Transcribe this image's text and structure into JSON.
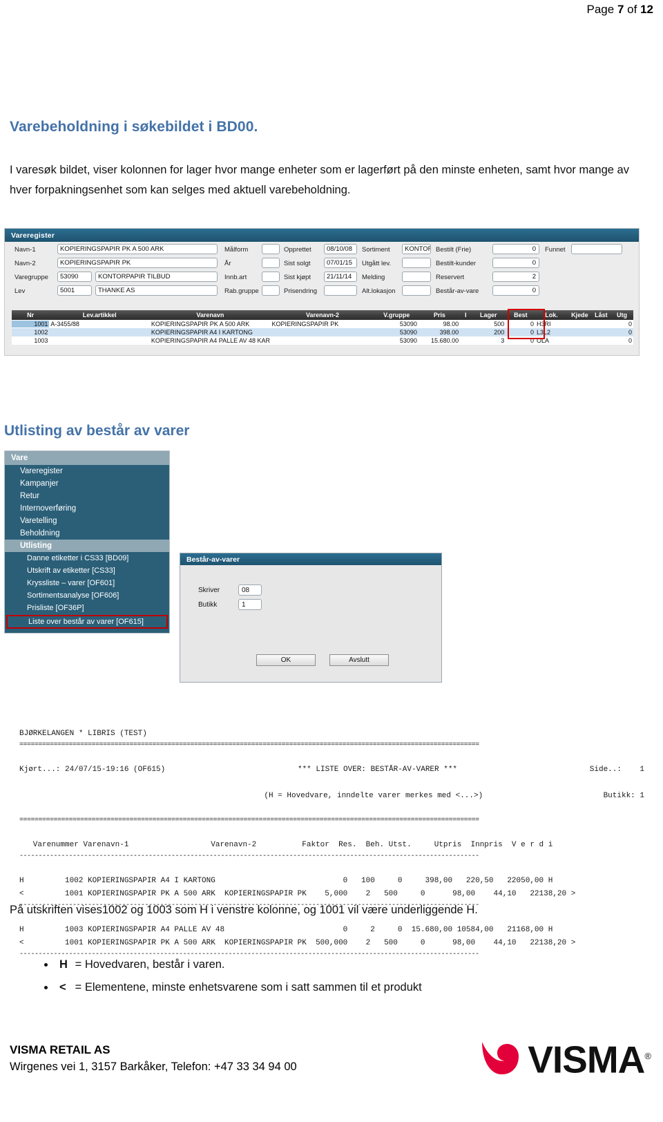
{
  "page_header": {
    "prefix": "Page",
    "current": "7",
    "middle": "of",
    "total": "12"
  },
  "section1": {
    "title": "Varebeholdning i søkebildet i BD00.",
    "intro": "I varesøk bildet, viser kolonnen for lager hvor mange enheter som er lagerført på den minste enheten, samt hvor mange av hver forpakningsenhet som kan selges med aktuell varebeholdning."
  },
  "vareregister": {
    "window_title": "Vareregister",
    "fields": {
      "navn1_label": "Navn-1",
      "navn1_value": "KOPIERINGSPAPIR PK A 500 ARK",
      "navn2_label": "Navn-2",
      "navn2_value": "KOPIERINGSPAPIR PK",
      "varegruppe_label": "Varegruppe",
      "varegruppe_code": "53090",
      "varegruppe_text": "KONTORPAPIR TILBUD",
      "lev_label": "Lev",
      "lev_code": "5001",
      "lev_text": "THANKE AS",
      "malform_label": "Målform",
      "malform_value": "",
      "ar_label": "År",
      "ar_value": "",
      "innbart_label": "Innb.art",
      "innbart_value": "",
      "rabgruppe_label": "Rab.gruppe",
      "rabgruppe_value": "",
      "opprettet_label": "Opprettet",
      "opprettet_value": "08/10/08",
      "sistsolgt_label": "Sist solgt",
      "sistsolgt_value": "07/01/15",
      "sistkjopt_label": "Sist kjøpt",
      "sistkjopt_value": "21/11/14",
      "prisendring_label": "Prisendring",
      "prisendring_value": "",
      "sortiment_label": "Sortiment",
      "sortiment_value": "KONTOR",
      "utgattlev_label": "Utgått lev.",
      "utgattlev_value": "",
      "melding_label": "Melding",
      "melding_value": "",
      "altlokasjon_label": "Alt.lokasjon",
      "altlokasjon_value": "",
      "bestiltfrie_label": "Bestilt (Frie)",
      "bestiltfrie_value": "0",
      "bestiltkunder_label": "Bestilt-kunder",
      "bestiltkunder_value": "0",
      "reservert_label": "Reservert",
      "reservert_value": "2",
      "bestaravvare_label": "Består-av-vare",
      "bestaravvare_value": "0",
      "funnet_label": "Funnet",
      "funnet_value": ""
    },
    "grid": {
      "columns": [
        "Nr",
        "Lev.artikkel",
        "Varenavn",
        "Varenavn-2",
        "V.gruppe",
        "Pris",
        "I",
        "Lager",
        "Best",
        "Lok.",
        "Kjede",
        "Låst",
        "Utg"
      ],
      "rows": [
        {
          "nr": "1001",
          "lev": "A-3455/88",
          "navn": "KOPIERINGSPAPIR PK A 500 ARK",
          "navn2": "KOPIERINGSPAPIR PK",
          "vgruppe": "53090",
          "pris": "98.00",
          "i": "",
          "lager": "500",
          "best": "0",
          "lok": "H3RI",
          "kjede": "",
          "last": "",
          "utg": "0"
        },
        {
          "nr": "1002",
          "lev": "",
          "navn": "KOPIERINGSPAPIR A4 I KARTONG",
          "navn2": "",
          "vgruppe": "53090",
          "pris": "398.00",
          "i": "",
          "lager": "200",
          "best": "0",
          "lok": "L3L2",
          "kjede": "",
          "last": "",
          "utg": "0"
        },
        {
          "nr": "1003",
          "lev": "",
          "navn": "KOPIERINGSPAPIR A4 PALLE AV 48 KAR",
          "navn2": "",
          "vgruppe": "53090",
          "pris": "15.680.00",
          "i": "",
          "lager": "3",
          "best": "0",
          "lok": "OLA",
          "kjede": "",
          "last": "",
          "utg": "0"
        }
      ],
      "highlight_column": "Lager",
      "highlight_color": "#d40000"
    }
  },
  "section2": {
    "title": "Utlisting av består av varer"
  },
  "menu": {
    "root": "Vare",
    "items": [
      {
        "label": "Vareregister",
        "selected": false
      },
      {
        "label": "Kampanjer",
        "selected": false
      },
      {
        "label": "Retur",
        "selected": false
      },
      {
        "label": "Internoverføring",
        "selected": false
      },
      {
        "label": "Varetelling",
        "selected": false
      },
      {
        "label": "Beholdning",
        "selected": false
      },
      {
        "label": "Utlisting",
        "selected": true
      }
    ],
    "sub_items": [
      {
        "label": "Danne etiketter i CS33  [BD09]",
        "boxed": false
      },
      {
        "label": "Utskrift av etiketter  [CS33]",
        "boxed": false
      },
      {
        "label": "Kryssliste – varer  [OF601]",
        "boxed": false
      },
      {
        "label": "Sortimentsanalyse  [OF606]",
        "boxed": false
      },
      {
        "label": "Prisliste  [OF36P]",
        "boxed": false
      },
      {
        "label": "Liste over består av varer  [OF615]",
        "boxed": true
      }
    ]
  },
  "dialog": {
    "title": "Består-av-varer",
    "skriver_label": "Skriver",
    "skriver_value": "08",
    "butikk_label": "Butikk",
    "butikk_value": "1",
    "ok_label": "OK",
    "cancel_label": "Avslutt"
  },
  "report": {
    "company_line": "BJØRKELANGEN * LIBRIS (TEST)",
    "rule_heavy": "=========================================================================================================================",
    "rule_light": "-------------------------------------------------------------------------------------------------------------------------",
    "run_line_left": "Kjørt...: 24/07/15-19:16 (OF615)",
    "run_line_center": "*** LISTE OVER: BESTÅR-AV-VARER ***",
    "run_line_right": "Side..:    1",
    "note_center": "(H = Hovedvare, inndelte varer merkes med <...>)",
    "note_right": "Butikk: 1",
    "col_header": "   Varenummer Varenavn-1                  Varenavn-2          Faktor  Res.  Beh. Utst.     Utpris  Innpris  V e r d i",
    "rows": [
      "H         1002 KOPIERINGSPAPIR A4 I KARTONG                            0   100     0     398,00   220,50   22050,00 H",
      "<         1001 KOPIERINGSPAPIR PK A 500 ARK  KOPIERINGSPAPIR PK    5,000    2   500     0      98,00    44,10   22138,20 >",
      "H         1003 KOPIERINGSPAPIR A4 PALLE AV 48                          0     2     0  15.680,00 10584,00   21168,00 H",
      "<         1001 KOPIERINGSPAPIR PK A 500 ARK  KOPIERINGSPAPIR PK  500,000    2   500     0      98,00    44,10   22138,20 >"
    ]
  },
  "section3": {
    "outro": "På utskriften vises1002 og 1003 som H i venstre kolonne, og 1001 vil være underliggende H.",
    "legend": [
      {
        "symbol": "H",
        "text": "= Hovedvaren, består i varen."
      },
      {
        "symbol": "<",
        "text": "= Elementene, minste enhetsvarene som i satt sammen til et produkt"
      }
    ]
  },
  "footer": {
    "company": "VISMA RETAIL AS",
    "address": "Wirgenes vei 1, 3157 Barkåker, Telefon: +47 33 34 94 00",
    "logo_word": "VISMA",
    "logo_color": "#e3003a"
  }
}
